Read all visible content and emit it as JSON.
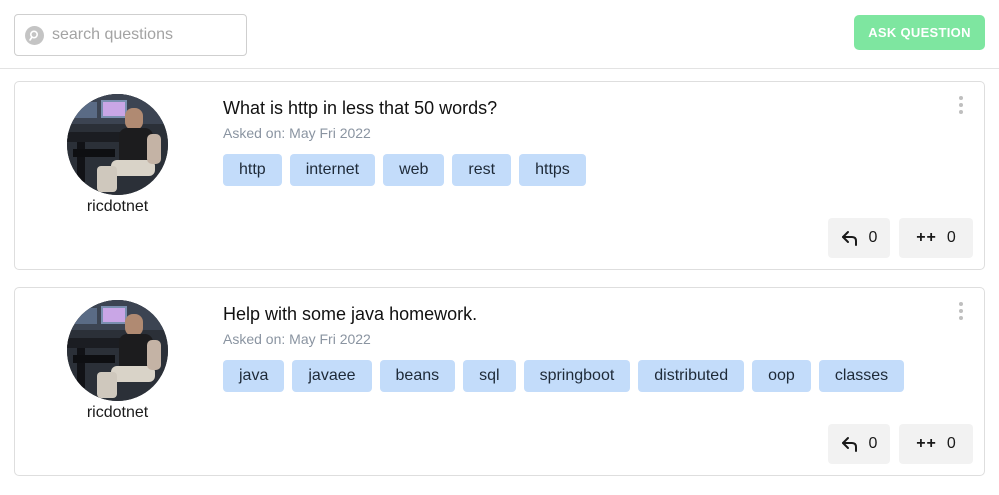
{
  "search": {
    "placeholder": "search questions"
  },
  "toolbar": {
    "ask_label": "ASK QUESTION"
  },
  "colors": {
    "accent": "#7ee6a0",
    "tag_bg": "#c3dcfa",
    "action_bg": "#f2f2f2"
  },
  "questions": [
    {
      "user": "ricdotnet",
      "title": "What is http in less that 50 words?",
      "date": "Asked on: May Fri 2022",
      "tags": [
        "http",
        "internet",
        "web",
        "rest",
        "https"
      ],
      "replies": "0",
      "plus_label": "++",
      "plus_count": "0"
    },
    {
      "user": "ricdotnet",
      "title": "Help with some java homework.",
      "date": "Asked on: May Fri 2022",
      "tags": [
        "java",
        "javaee",
        "beans",
        "sql",
        "springboot",
        "distributed",
        "oop",
        "classes"
      ],
      "replies": "0",
      "plus_label": "++",
      "plus_count": "0"
    }
  ]
}
